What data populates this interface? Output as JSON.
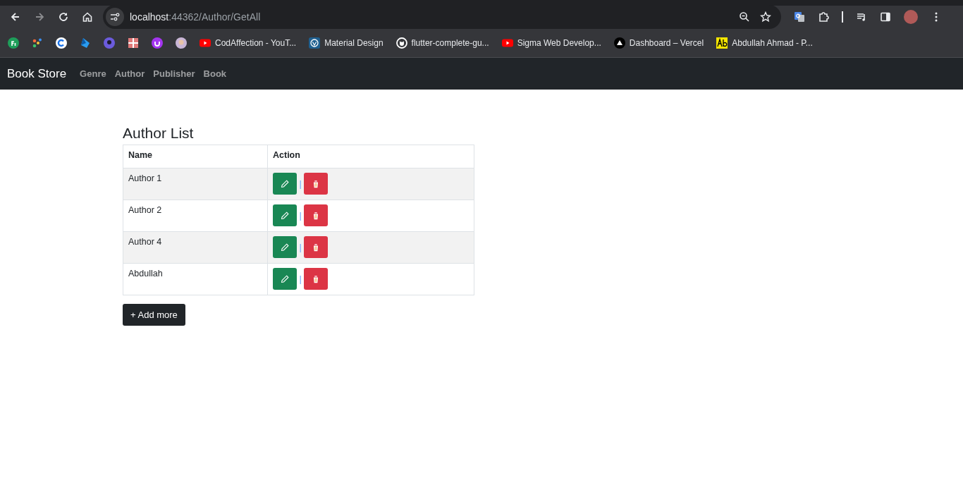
{
  "browser": {
    "url_host": "localhost",
    "url_rest": ":44362/Author/GetAll",
    "bookmarks": [
      {
        "kind": "green-circle"
      },
      {
        "kind": "dots"
      },
      {
        "kind": "c-circle"
      },
      {
        "kind": "blue-leaf"
      },
      {
        "kind": "purple-circle"
      },
      {
        "kind": "grid"
      },
      {
        "kind": "purple-u"
      },
      {
        "kind": "avatar"
      },
      {
        "kind": "play",
        "label": "CodAffection - YouT..."
      },
      {
        "kind": "blue-badge",
        "label": "Material Design"
      },
      {
        "kind": "github",
        "label": "flutter-complete-gu..."
      },
      {
        "kind": "play",
        "label": "Sigma Web Develop..."
      },
      {
        "kind": "triangle",
        "label": "Dashboard – Vercel"
      },
      {
        "kind": "ab",
        "label": "Abdullah Ahmad - P..."
      }
    ]
  },
  "navbar": {
    "brand": "Book Store",
    "links": [
      "Genre",
      "Author",
      "Publisher",
      "Book"
    ]
  },
  "page": {
    "title": "Author List",
    "table": {
      "columns": [
        "Name",
        "Action"
      ],
      "rows": [
        {
          "name": "Author 1",
          "separator": "|"
        },
        {
          "name": "Author 2",
          "separator": "|"
        },
        {
          "name": "Author 4",
          "separator": "|"
        },
        {
          "name": "Abdullah",
          "separator": "|"
        }
      ]
    },
    "add_button": "+ Add more"
  }
}
